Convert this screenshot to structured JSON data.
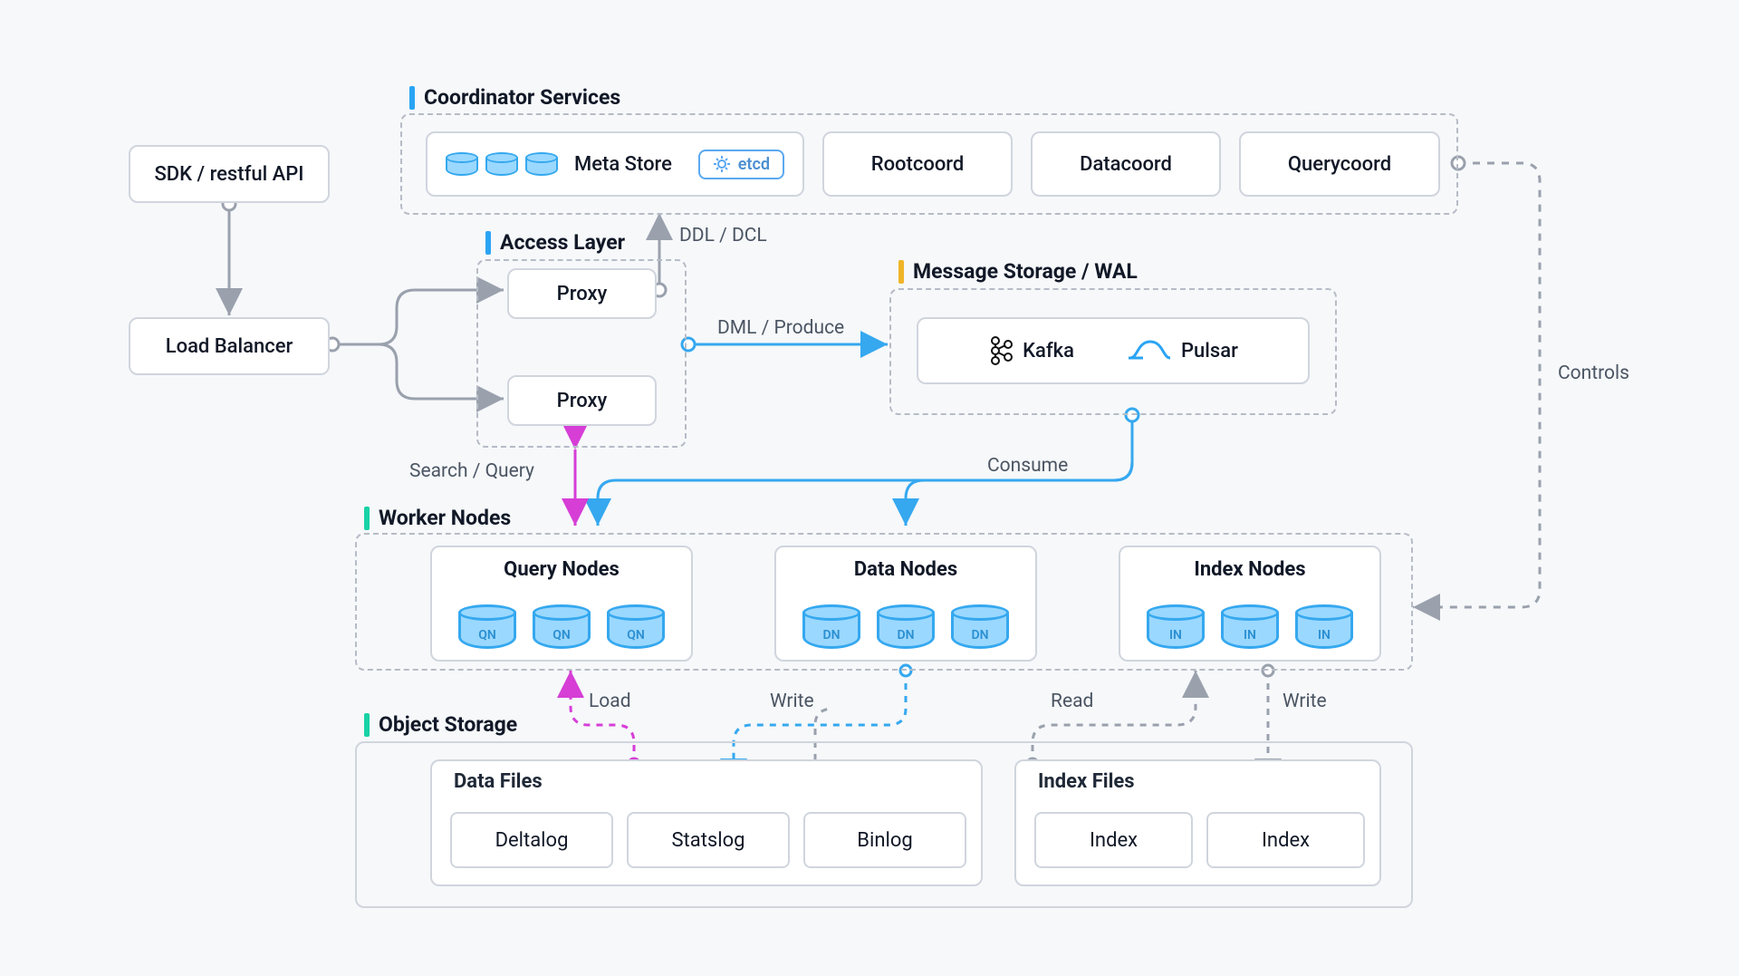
{
  "sdk": {
    "label": "SDK / restful API"
  },
  "load_balancer": {
    "label": "Load Balancer"
  },
  "coord": {
    "title": "Coordinator Services",
    "meta_store": "Meta Store",
    "etcd": "etcd",
    "rootcoord": "Rootcoord",
    "datacoord": "Datacoord",
    "querycoord": "Querycoord"
  },
  "access": {
    "title": "Access Layer",
    "proxy": "Proxy"
  },
  "msg": {
    "title": "Message Storage / WAL",
    "kafka": "Kafka",
    "pulsar": "Pulsar"
  },
  "worker": {
    "title": "Worker Nodes",
    "query": {
      "title": "Query Nodes",
      "tag": "QN"
    },
    "data": {
      "title": "Data Nodes",
      "tag": "DN"
    },
    "index": {
      "title": "Index Nodes",
      "tag": "IN"
    }
  },
  "obj": {
    "title": "Object Storage",
    "data_files": "Data Files",
    "index_files": "Index Files",
    "deltalog": "Deltalog",
    "statslog": "Statslog",
    "binlog": "Binlog",
    "index": "Index"
  },
  "labels": {
    "ddl": "DDL / DCL",
    "dml": "DML / Produce",
    "search": "Search / Query",
    "consume": "Consume",
    "load": "Load",
    "write": "Write",
    "read": "Read",
    "controls": "Controls"
  }
}
